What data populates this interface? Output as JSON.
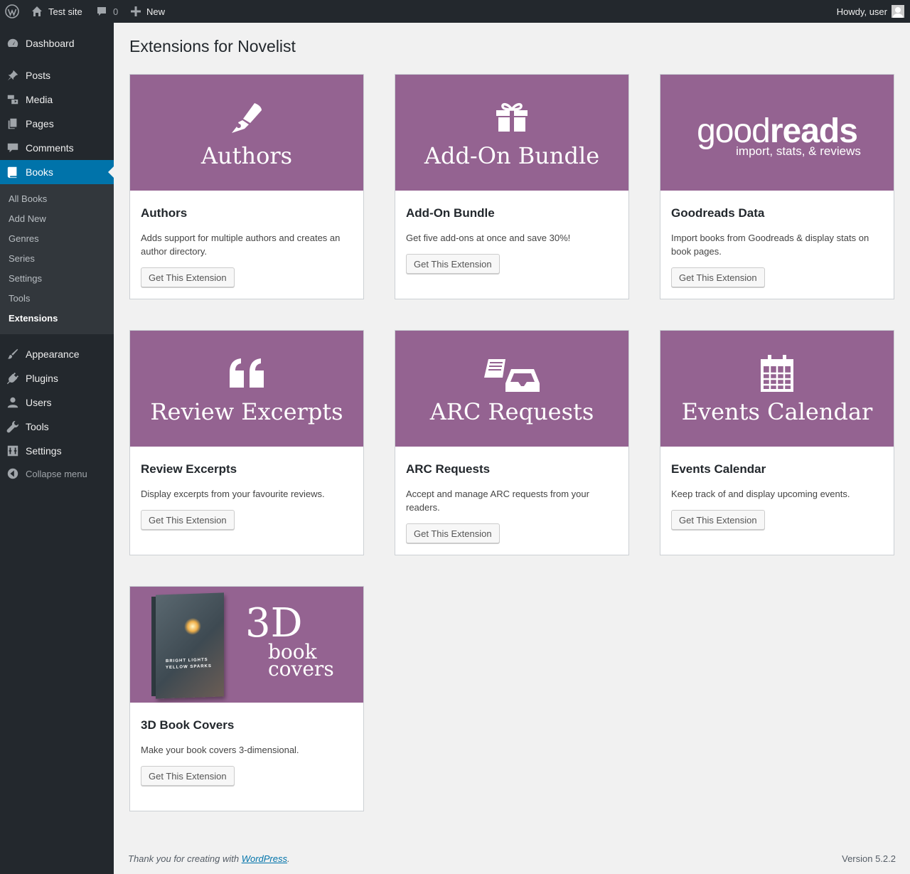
{
  "adminbar": {
    "site_name": "Test site",
    "comments_count": "0",
    "new_label": "New",
    "howdy": "Howdy, user"
  },
  "menu": {
    "items": [
      {
        "label": "Dashboard",
        "icon": "dashboard-icon"
      },
      {
        "label": "Posts",
        "icon": "pin-icon"
      },
      {
        "label": "Media",
        "icon": "media-icon"
      },
      {
        "label": "Pages",
        "icon": "pages-icon"
      },
      {
        "label": "Comments",
        "icon": "comment-icon"
      },
      {
        "label": "Books",
        "icon": "book-icon"
      },
      {
        "label": "Appearance",
        "icon": "brush-icon"
      },
      {
        "label": "Plugins",
        "icon": "plug-icon"
      },
      {
        "label": "Users",
        "icon": "user-icon"
      },
      {
        "label": "Tools",
        "icon": "wrench-icon"
      },
      {
        "label": "Settings",
        "icon": "settings-icon"
      }
    ],
    "collapse": "Collapse menu",
    "submenu": [
      "All Books",
      "Add New",
      "Genres",
      "Series",
      "Settings",
      "Tools",
      "Extensions"
    ]
  },
  "page": {
    "title": "Extensions for Novelist"
  },
  "extensions": [
    {
      "banner": "Authors",
      "title": "Authors",
      "desc": "Adds support for multiple authors and creates an author directory.",
      "button": "Get This Extension",
      "icon": "pen-icon"
    },
    {
      "banner": "Add-On Bundle",
      "title": "Add-On Bundle",
      "desc": "Get five add-ons at once and save 30%!",
      "button": "Get This Extension",
      "icon": "gift-icon"
    },
    {
      "banner_logo_thin": "good",
      "banner_logo_bold": "reads",
      "banner_sub": "import, stats, & reviews",
      "title": "Goodreads Data",
      "desc": "Import books from Goodreads & display stats on book pages.",
      "button": "Get This Extension"
    },
    {
      "banner": "Review Excerpts",
      "title": "Review Excerpts",
      "desc": "Display excerpts from your favourite reviews.",
      "button": "Get This Extension",
      "icon": "quote-icon"
    },
    {
      "banner": "ARC Requests",
      "title": "ARC Requests",
      "desc": "Accept and manage ARC requests from your readers.",
      "button": "Get This Extension",
      "icon": "inbox-book-icon"
    },
    {
      "banner": "Events Calendar",
      "title": "Events Calendar",
      "desc": "Keep track of and display upcoming events.",
      "button": "Get This Extension",
      "icon": "calendar-icon"
    },
    {
      "banner_big": "3D",
      "banner_line1": "book",
      "banner_line2": "covers",
      "book_text": "BRIGHT LIGHTS YELLOW SPARKS",
      "title": "3D Book Covers",
      "desc": "Make your book covers 3-dimensional.",
      "button": "Get This Extension"
    }
  ],
  "footer": {
    "thanks_prefix": "Thank you for creating with ",
    "thanks_link": "WordPress",
    "thanks_suffix": ".",
    "version": "Version 5.2.2"
  },
  "colors": {
    "accent": "#0073aa",
    "banner": "#946391",
    "sidebar": "#23282d"
  }
}
